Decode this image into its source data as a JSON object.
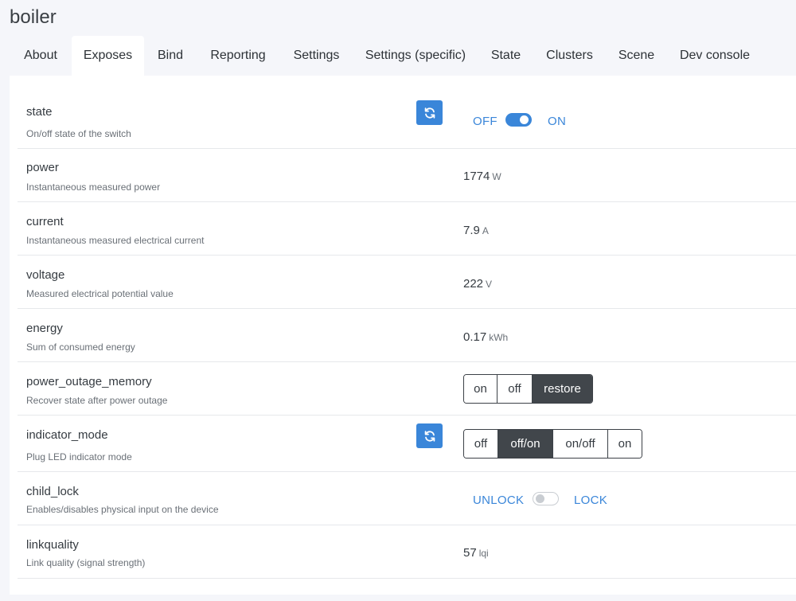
{
  "page": {
    "title": "boiler"
  },
  "tabs": [
    {
      "label": "About"
    },
    {
      "label": "Exposes"
    },
    {
      "label": "Bind"
    },
    {
      "label": "Reporting"
    },
    {
      "label": "Settings"
    },
    {
      "label": "Settings (specific)"
    },
    {
      "label": "State"
    },
    {
      "label": "Clusters"
    },
    {
      "label": "Scene"
    },
    {
      "label": "Dev console"
    }
  ],
  "active_tab": "Exposes",
  "colors": {
    "accent": "#3a86d9",
    "selected_segment": "#41464b"
  },
  "exposes": {
    "state": {
      "name": "state",
      "description": "On/off state of the switch",
      "off_label": "OFF",
      "on_label": "ON",
      "value": "ON",
      "refresh_icon": "refresh-icon"
    },
    "power": {
      "name": "power",
      "description": "Instantaneous measured power",
      "value": "1774",
      "unit": "W"
    },
    "current": {
      "name": "current",
      "description": "Instantaneous measured electrical current",
      "value": "7.9",
      "unit": "A"
    },
    "voltage": {
      "name": "voltage",
      "description": "Measured electrical potential value",
      "value": "222",
      "unit": "V"
    },
    "energy": {
      "name": "energy",
      "description": "Sum of consumed energy",
      "value": "0.17",
      "unit": "kWh"
    },
    "power_outage_memory": {
      "name": "power_outage_memory",
      "description": "Recover state after power outage",
      "options": [
        "on",
        "off",
        "restore"
      ],
      "selected": "restore"
    },
    "indicator_mode": {
      "name": "indicator_mode",
      "description": "Plug LED indicator mode",
      "options": [
        "off",
        "off/on",
        "on/off",
        "on"
      ],
      "selected": "off/on",
      "refresh_icon": "refresh-icon"
    },
    "child_lock": {
      "name": "child_lock",
      "description": "Enables/disables physical input on the device",
      "off_label": "UNLOCK",
      "on_label": "LOCK",
      "value": "UNLOCK"
    },
    "linkquality": {
      "name": "linkquality",
      "description": "Link quality (signal strength)",
      "value": "57",
      "unit": "lqi"
    }
  }
}
